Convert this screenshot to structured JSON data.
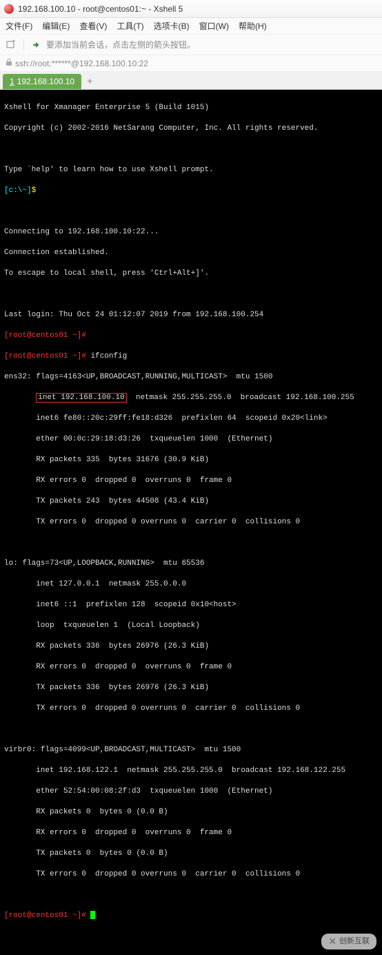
{
  "titlebar": {
    "text": "192.168.100.10 - root@centos01:~ - Xshell 5"
  },
  "menubar": [
    "文件(F)",
    "编辑(E)",
    "查看(V)",
    "工具(T)",
    "选项卡(B)",
    "窗口(W)",
    "帮助(H)"
  ],
  "toolbar": {
    "tip": "要添加当前会话，点击左侧的箭头按钮。"
  },
  "sshbar": {
    "text": "ssh://root:******@192.168.100.10:22"
  },
  "tab": {
    "num": "1",
    "label": "192.168.100.10"
  },
  "tab_add": "+",
  "terminal": {
    "banner1": "Xshell for Xmanager Enterprise 5 (Build 1015)",
    "banner2": "Copyright (c) 2002-2016 NetSarang Computer, Inc. All rights reserved.",
    "help": "Type `help' to learn how to use Xshell prompt.",
    "localprompt_open": "[c:\\~]",
    "localprompt_dollar": "$",
    "connecting": "Connecting to 192.168.100.10:22...",
    "established": "Connection established.",
    "escape": "To escape to local shell, press 'Ctrl+Alt+]'.",
    "lastlogin": "Last login: Thu Oct 24 01:12:07 2019 from 192.168.100.254",
    "prompt1a": "[",
    "prompt1b": "root@centos01",
    "prompt1c": " ~]#",
    "cmd1": " ifconfig",
    "ens_header": "ens32: flags=4163<UP,BROADCAST,RUNNING,MULTICAST>  mtu 1500",
    "ens_inet_pad": "       ",
    "ens_inet_hl": "inet 192.168.100.10",
    "ens_inet_rest": "  netmask 255.255.255.0  broadcast 192.168.100.255",
    "ens_inet6": "       inet6 fe80::20c:29ff:fe18:d326  prefixlen 64  scopeid 0x20<link>",
    "ens_ether": "       ether 00:0c:29:18:d3:26  txqueuelen 1000  (Ethernet)",
    "ens_rx1": "       RX packets 335  bytes 31676 (30.9 KiB)",
    "ens_rx2": "       RX errors 0  dropped 0  overruns 0  frame 0",
    "ens_tx1": "       TX packets 243  bytes 44508 (43.4 KiB)",
    "ens_tx2": "       TX errors 0  dropped 0 overruns 0  carrier 0  collisions 0",
    "lo_header": "lo: flags=73<UP,LOOPBACK,RUNNING>  mtu 65536",
    "lo_inet": "       inet 127.0.0.1  netmask 255.0.0.0",
    "lo_inet6": "       inet6 ::1  prefixlen 128  scopeid 0x10<host>",
    "lo_loop": "       loop  txqueuelen 1  (Local Loopback)",
    "lo_rx1": "       RX packets 336  bytes 26976 (26.3 KiB)",
    "lo_rx2": "       RX errors 0  dropped 0  overruns 0  frame 0",
    "lo_tx1": "       TX packets 336  bytes 26976 (26.3 KiB)",
    "lo_tx2": "       TX errors 0  dropped 0 overruns 0  carrier 0  collisions 0",
    "vb_header": "virbr0: flags=4099<UP,BROADCAST,MULTICAST>  mtu 1500",
    "vb_inet": "       inet 192.168.122.1  netmask 255.255.255.0  broadcast 192.168.122.255",
    "vb_ether": "       ether 52:54:00:08:2f:d3  txqueuelen 1000  (Ethernet)",
    "vb_rx1": "       RX packets 0  bytes 0 (0.0 B)",
    "vb_rx2": "       RX errors 0  dropped 0  overruns 0  frame 0",
    "vb_tx1": "       TX packets 0  bytes 0 (0.0 B)",
    "vb_tx2": "       TX errors 0  dropped 0 overruns 0  carrier 0  collisions 0",
    "prompt_end_a": "[",
    "prompt_end_b": "root@centos01",
    "prompt_end_c": " ~]# "
  },
  "watermark": "创新互联"
}
